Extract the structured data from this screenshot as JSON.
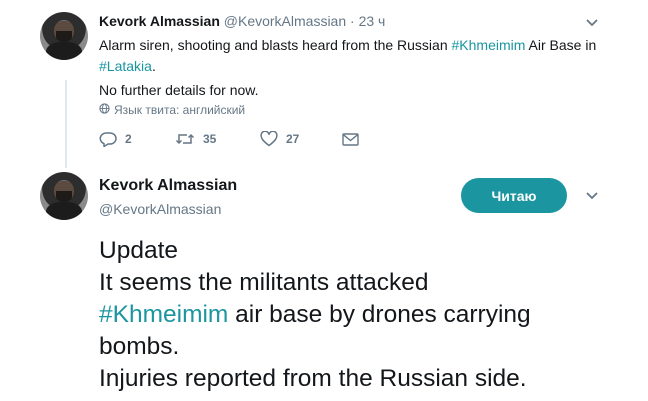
{
  "tweet1": {
    "author_name": "Kevork Almassian",
    "author_handle": "@KevorkAlmassian",
    "separator": "·",
    "time": "23 ч",
    "text_before": "Alarm siren, shooting and blasts heard from the Russian ",
    "hashtag1": "#Khmeimim",
    "text_middle": " Air Base in",
    "hashtag2": "#Latakia",
    "text_after": ".",
    "text_line2": "No further details for now.",
    "language_note": "Язык твита: английский",
    "reply_count": "2",
    "retweet_count": "35",
    "like_count": "27"
  },
  "tweet2": {
    "author_name": "Kevork Almassian",
    "author_handle": "@KevorkAlmassian",
    "follow_label": "Читаю",
    "line1": "Update",
    "line2": "It seems the militants attacked",
    "hashtag": "#Khmeimim",
    "line3_rest": " air base by drones carrying",
    "line4": "bombs.",
    "line5": "Injuries reported from the Russian side."
  },
  "colors": {
    "accent": "#1b95a0",
    "text": "#14171a",
    "muted": "#657786",
    "thread_line": "#e1e8ed"
  },
  "icons": [
    "avatar",
    "chevron-down-icon",
    "globe-icon",
    "reply-icon",
    "retweet-icon",
    "like-icon",
    "message-icon"
  ]
}
